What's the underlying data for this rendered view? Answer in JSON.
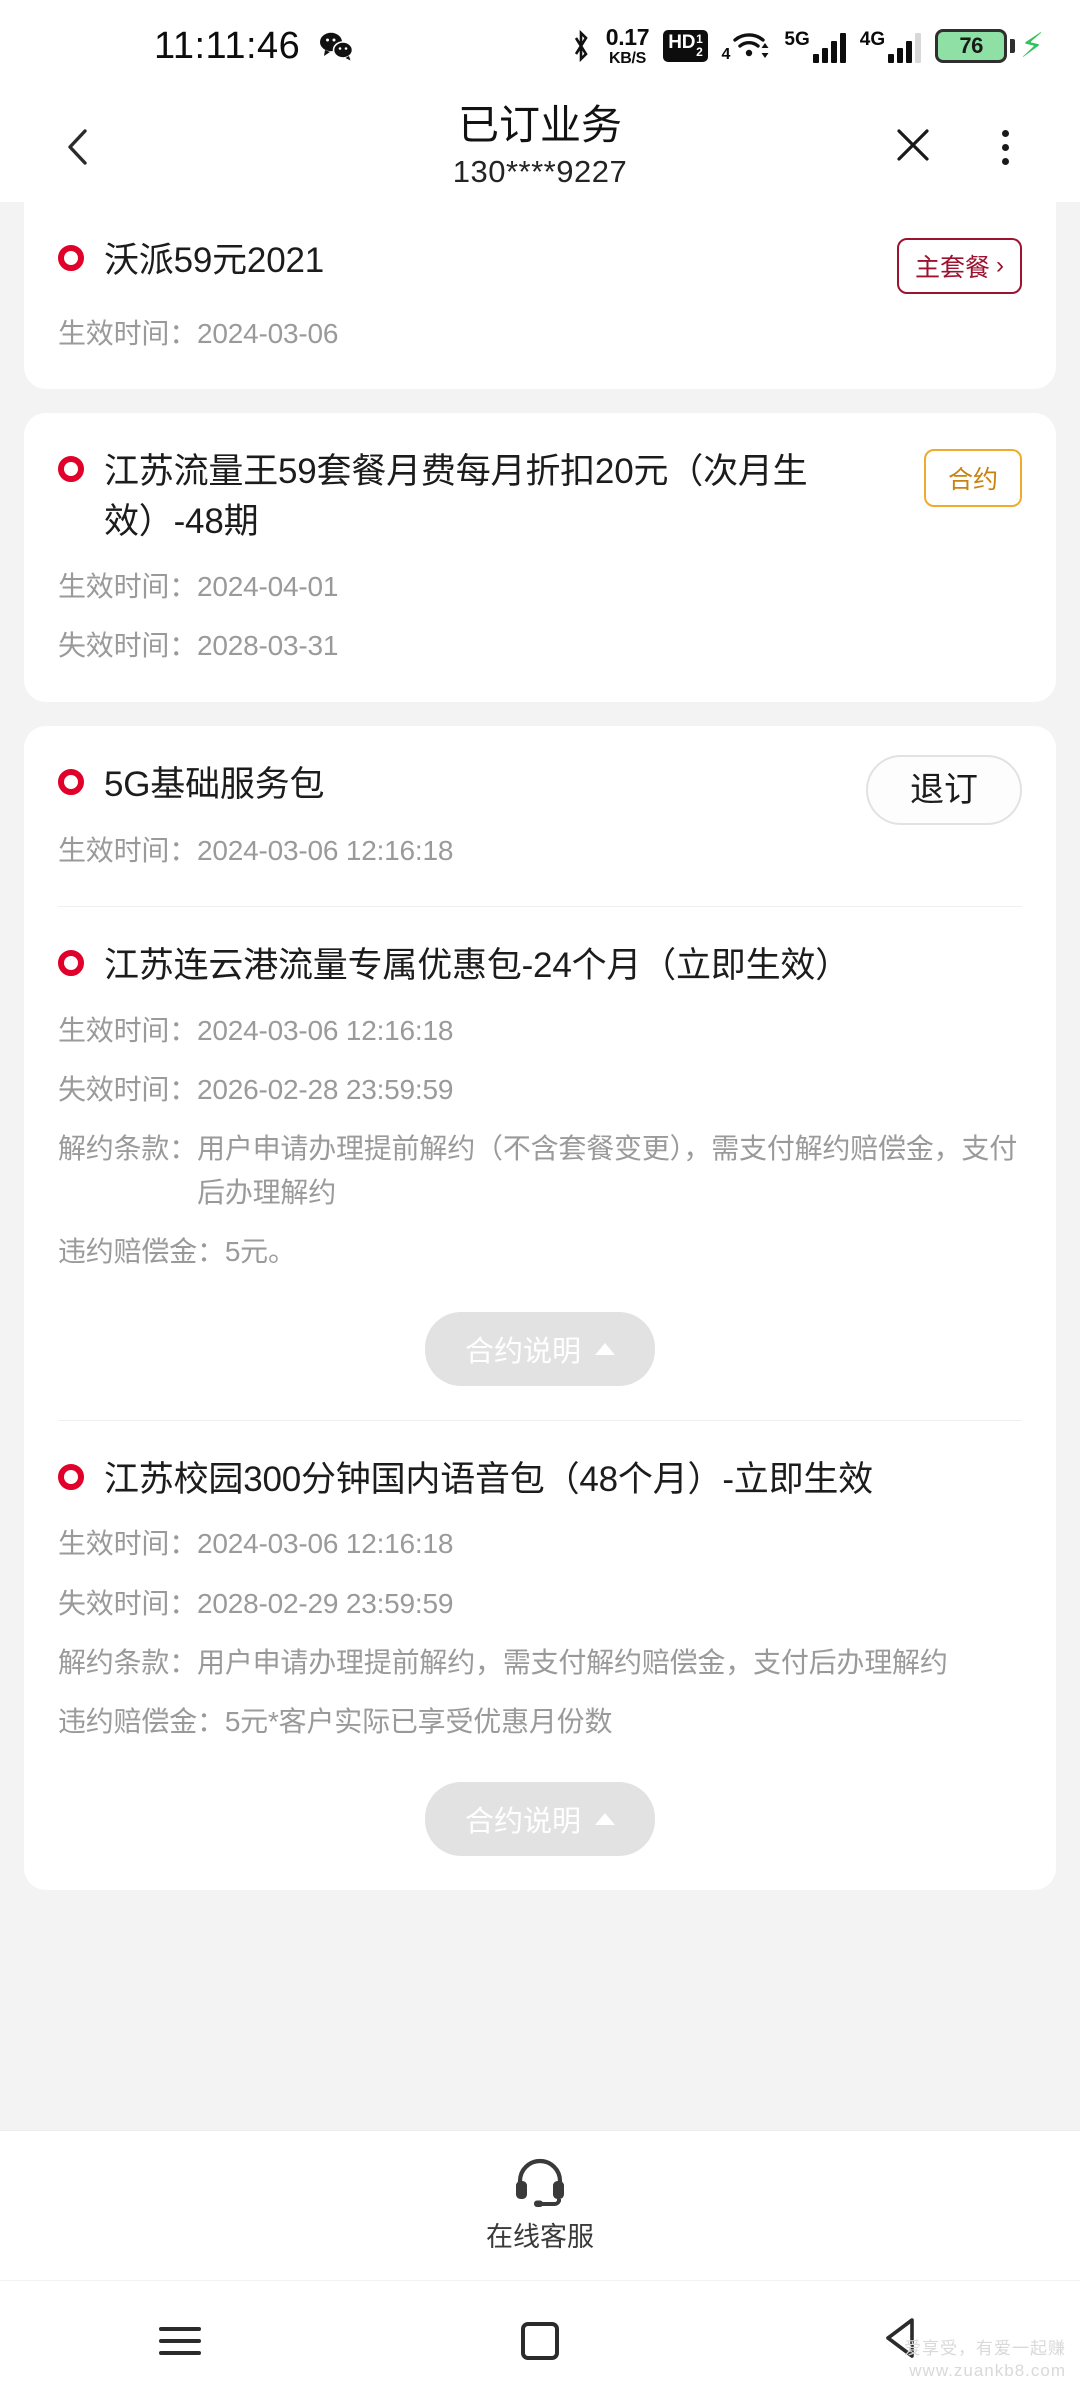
{
  "status_bar": {
    "time": "11:11:46",
    "wechat_icon": "wechat-icon",
    "bluetooth_icon": "bluetooth-icon",
    "net_speed_value": "0.17",
    "net_speed_unit": "KB/S",
    "hd_badge": "HD",
    "hd_sup": "1",
    "hd_sub": "2",
    "wifi_icon": "wifi-icon",
    "wifi_sub": "4",
    "sim1_label": "5G",
    "sim2_label": "4G",
    "battery_level": "76",
    "charging_icon": "lightning-bolt-icon",
    "battery_green": "#8fe0a4"
  },
  "header": {
    "back_icon": "chevron-left-icon",
    "title": "已订业务",
    "subtitle": "130****9227",
    "close_icon": "close-icon",
    "more_icon": "more-vertical-icon"
  },
  "labels": {
    "effective_time": "生效时间：",
    "expire_time": "失效时间：",
    "terminate_terms": "解约条款：",
    "penalty": "违约赔偿金：",
    "contract_desc": "合约说明"
  },
  "cards": [
    {
      "card_id": "card-1",
      "services": [
        {
          "name": "沃派59元2021",
          "action_type": "badge-main",
          "action_label": "主套餐",
          "action_arrow": "›",
          "rows": [
            {
              "label": "生效时间：",
              "value": "2024-03-06"
            }
          ],
          "has_contract_button": false
        }
      ]
    },
    {
      "card_id": "card-2",
      "services": [
        {
          "name": "江苏流量王59套餐月费每月折扣20元（次月生效）-48期",
          "action_type": "badge-contract",
          "action_label": "合约",
          "rows": [
            {
              "label": "生效时间：",
              "value": "2024-04-01"
            },
            {
              "label": "失效时间：",
              "value": "2028-03-31"
            }
          ],
          "has_contract_button": false
        }
      ]
    },
    {
      "card_id": "card-3",
      "services": [
        {
          "name": "5G基础服务包",
          "action_type": "button-unsub",
          "action_label": "退订",
          "rows": [
            {
              "label": "生效时间：",
              "value": "2024-03-06 12:16:18"
            }
          ],
          "has_contract_button": false
        },
        {
          "name": "江苏连云港流量专属优惠包-24个月（立即生效）",
          "action_type": "none",
          "action_label": "",
          "rows": [
            {
              "label": "生效时间：",
              "value": "2024-03-06 12:16:18"
            },
            {
              "label": "失效时间：",
              "value": "2026-02-28 23:59:59"
            },
            {
              "label": "解约条款：",
              "value": "用户申请办理提前解约（不含套餐变更），需支付解约赔偿金，支付后办理解约"
            },
            {
              "label": "违约赔偿金：",
              "value": "5元。"
            }
          ],
          "has_contract_button": true,
          "contract_button_label": "合约说明"
        },
        {
          "name": "江苏校园300分钟国内语音包（48个月）-立即生效",
          "action_type": "none",
          "action_label": "",
          "rows": [
            {
              "label": "生效时间：",
              "value": "2024-03-06 12:16:18"
            },
            {
              "label": "失效时间：",
              "value": "2028-02-29 23:59:59"
            },
            {
              "label": "解约条款：",
              "value": "用户申请办理提前解约，需支付解约赔偿金，支付后办理解约"
            },
            {
              "label": "违约赔偿金：",
              "value": "5元*客户实际已享受优惠月份数"
            }
          ],
          "has_contract_button": true,
          "contract_button_label": "合约说明"
        }
      ]
    }
  ],
  "service_bar": {
    "icon": "headset-icon",
    "label": "在线客服"
  },
  "nav_bar": {
    "recents_icon": "menu-icon",
    "home_icon": "home-square-icon",
    "back_icon": "back-triangle-icon"
  },
  "watermark": {
    "line1": "www.zuankb8.com",
    "line2": "爱享受，有爱一起赚"
  },
  "colors": {
    "brand_red": "#e0002a",
    "badge_main": "#9c1330",
    "badge_contract": "#f0aa2c",
    "page_bg": "#f3f3f3",
    "card_bg": "#ffffff",
    "muted_text": "#9a9a9a"
  }
}
